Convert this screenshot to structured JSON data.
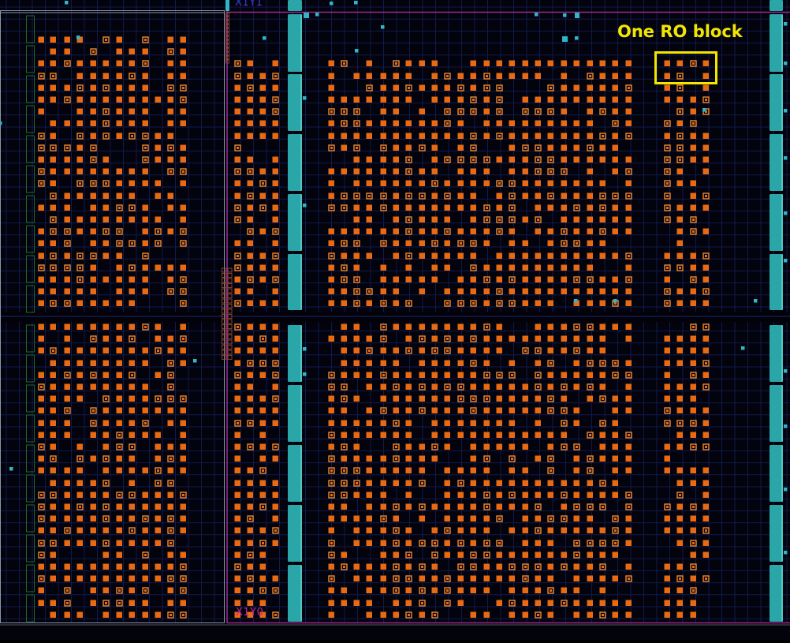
{
  "regions": {
    "upper_right": "X1Y1",
    "lower_right": "X1Y0"
  },
  "annotation": {
    "text": "One RO block"
  },
  "colors": {
    "background": "#03030d",
    "grid_line": "#111a4a",
    "grid_line_bright": "#1c2878",
    "clock_region_border": "#9a2a8a",
    "left_region_border": "#8a94a8",
    "cell_fill": "#e86a12",
    "cell_outline": "#f08a30",
    "bram_column": "#2aa6a8",
    "bram_edge": "#7fe0e0",
    "small_site": "#2fb6c8",
    "io_column": "#1e6a2a",
    "annotation": "#f2e600",
    "label_x1y1": "#3c3cd8",
    "label_x1y0": "#c0289c"
  }
}
